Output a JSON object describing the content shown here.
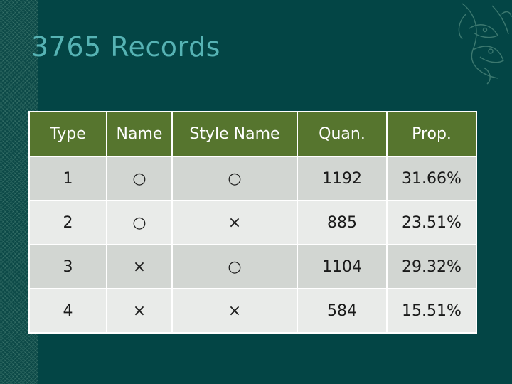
{
  "slide": {
    "title": "3765 Records"
  },
  "table": {
    "headers": [
      "Type",
      "Name",
      "Style Name",
      "Quan.",
      "Prop."
    ],
    "rows": [
      [
        "1",
        "○",
        "○",
        "1192",
        "31.66%"
      ],
      [
        "2",
        "○",
        "×",
        "885",
        "23.51%"
      ],
      [
        "3",
        "×",
        "○",
        "1104",
        "29.32%"
      ],
      [
        "4",
        "×",
        "×",
        "584",
        "15.51%"
      ]
    ]
  },
  "colors": {
    "background": "#034545",
    "title": "#56b3b4",
    "header_fill": "#56752e",
    "row_odd": "#d2d6d2",
    "row_even": "#e9ebe9"
  },
  "decorations": {
    "left_strip": "diamond-pattern",
    "corner": "floral-ornament-icon"
  }
}
